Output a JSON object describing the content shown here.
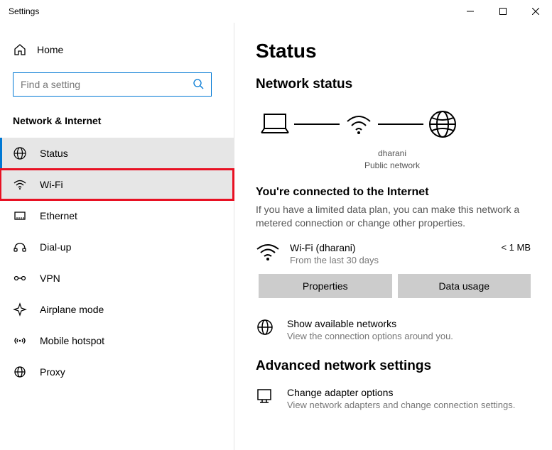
{
  "window": {
    "title": "Settings"
  },
  "sidebar": {
    "home": "Home",
    "search_placeholder": "Find a setting",
    "category": "Network & Internet",
    "items": [
      {
        "label": "Status"
      },
      {
        "label": "Wi-Fi"
      },
      {
        "label": "Ethernet"
      },
      {
        "label": "Dial-up"
      },
      {
        "label": "VPN"
      },
      {
        "label": "Airplane mode"
      },
      {
        "label": "Mobile hotspot"
      },
      {
        "label": "Proxy"
      }
    ]
  },
  "main": {
    "title": "Status",
    "network_status_heading": "Network status",
    "diagram": {
      "ssid": "dharani",
      "network_type": "Public network"
    },
    "connected_heading": "You're connected to the Internet",
    "connected_desc": "If you have a limited data plan, you can make this network a metered connection or change other properties.",
    "connection": {
      "name": "Wi-Fi (dharani)",
      "sub": "From the last 30 days",
      "usage": "< 1 MB"
    },
    "buttons": {
      "properties": "Properties",
      "data_usage": "Data usage"
    },
    "show_networks": {
      "title": "Show available networks",
      "desc": "View the connection options around you."
    },
    "advanced_heading": "Advanced network settings",
    "adapter": {
      "title": "Change adapter options",
      "desc": "View network adapters and change connection settings."
    }
  }
}
